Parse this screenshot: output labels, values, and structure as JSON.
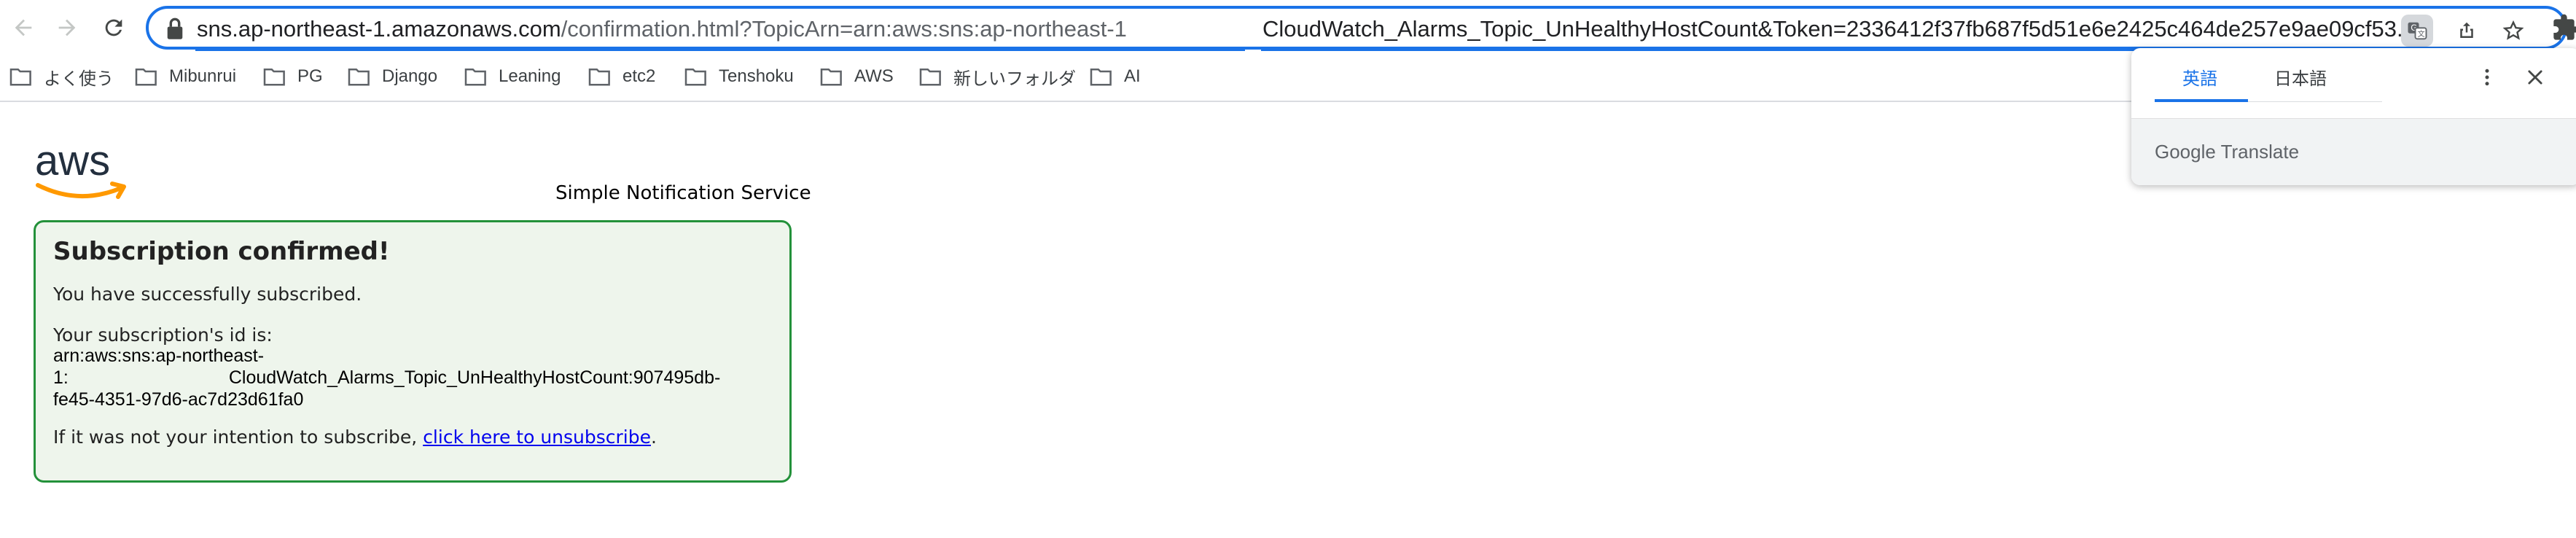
{
  "browser": {
    "url_host": "sns.ap-northeast-1.amazonaws.com",
    "url_path": "/confirmation.html?TopicArn=arn:aws:sns:ap-northeast-1",
    "url_tail": "CloudWatch_Alarms_Topic_UnHealthyHostCount&Token=2336412f37fb687f5d51e6e2425c464de257e9ae09cf53...",
    "icons": [
      "back-icon",
      "forward-icon",
      "reload-icon",
      "lock-icon",
      "translate-icon",
      "share-icon",
      "star-icon",
      "extensions-icon"
    ]
  },
  "bookmarks": [
    {
      "label": "よく使う"
    },
    {
      "label": "Mibunrui"
    },
    {
      "label": "PG"
    },
    {
      "label": "Django"
    },
    {
      "label": "Leaning"
    },
    {
      "label": "etc2"
    },
    {
      "label": "Tenshoku"
    },
    {
      "label": "AWS"
    },
    {
      "label": "新しいフォルダ"
    },
    {
      "label": "AI"
    }
  ],
  "page": {
    "logo_text": "aws",
    "service_name": "Simple Notification Service",
    "heading": "Subscription confirmed!",
    "success_text": "You have successfully subscribed.",
    "id_label": "Your subscription's id is:",
    "arn_line1": "arn:aws:sns:ap-northeast-",
    "arn_line2_prefix": "1:",
    "arn_line2_suffix": "CloudWatch_Alarms_Topic_UnHealthyHostCount:907495db-",
    "arn_line3": "fe45-4351-97d6-ac7d23d61fa0",
    "unsubscribe_prefix": "If it was not your intention to subscribe, ",
    "unsubscribe_link": "click here to unsubscribe",
    "unsubscribe_suffix": "."
  },
  "translate_popup": {
    "tab_source": "英語",
    "tab_target": "日本語",
    "brand_google": "Google",
    "brand_translate": "Translate",
    "active_color": "#1a73e8"
  }
}
